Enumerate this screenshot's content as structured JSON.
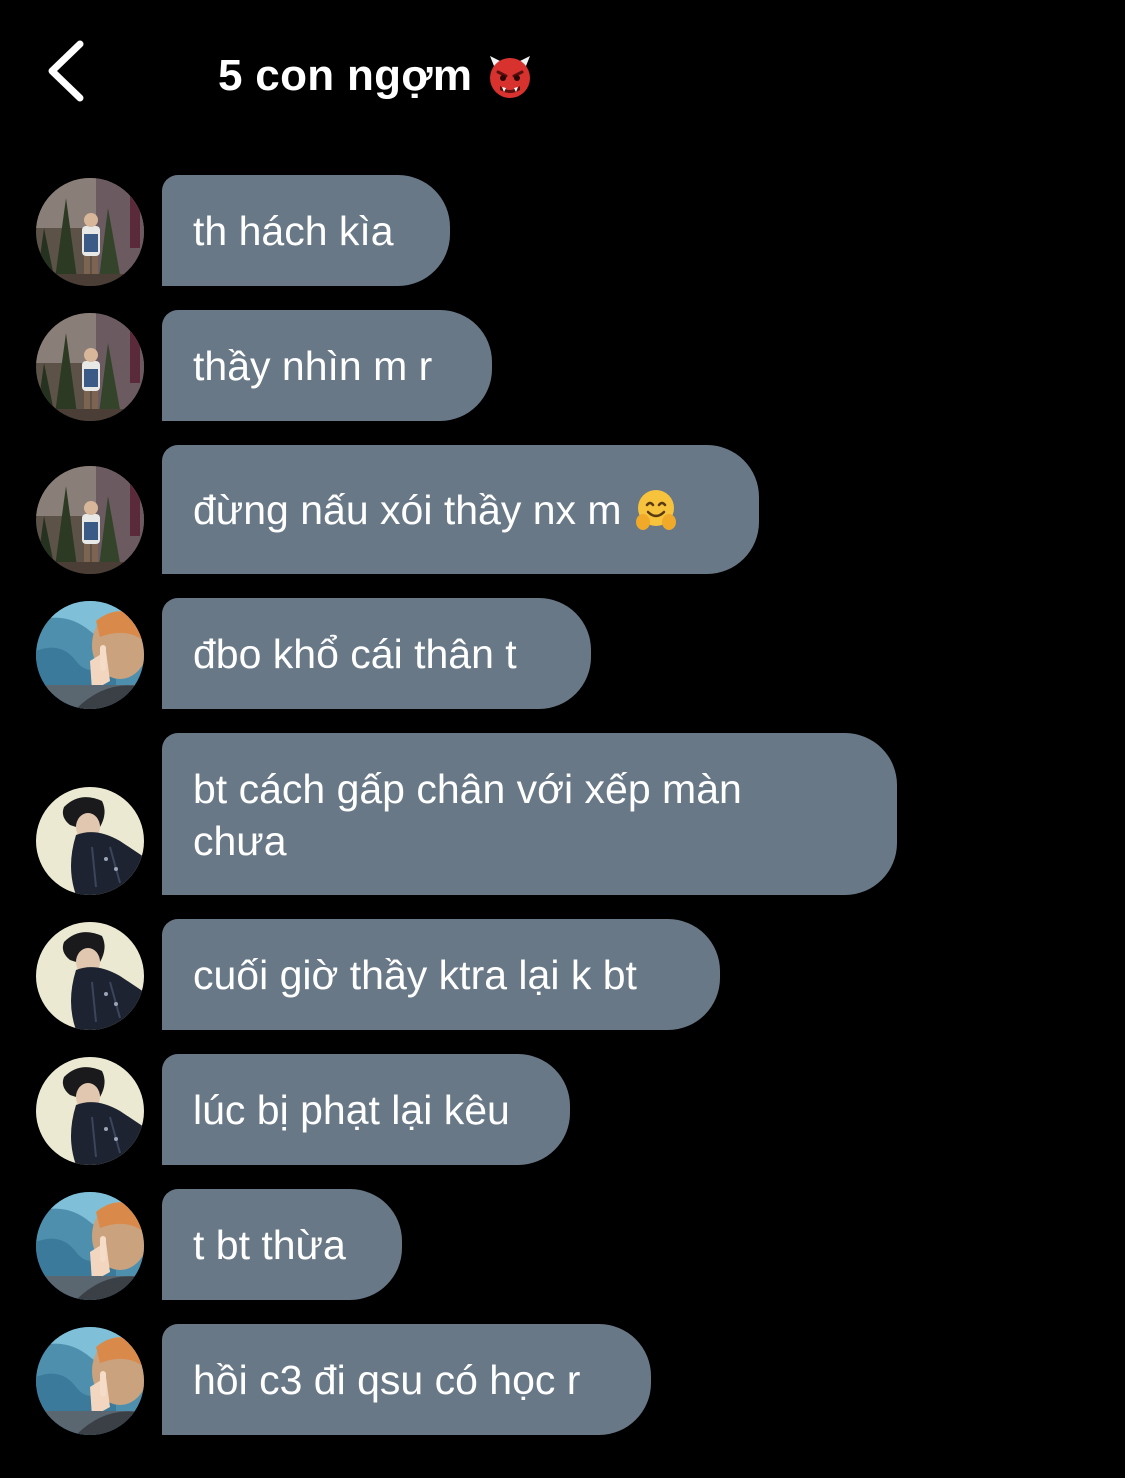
{
  "header": {
    "title": "5 con ngợm",
    "title_icon": "ogre-icon",
    "back_icon": "chevron-left-icon"
  },
  "colors": {
    "background": "#000000",
    "bubble": "#687887",
    "text": "#ffffff"
  },
  "messages": [
    {
      "avatar": "avatar-a",
      "text": "th hách kìa"
    },
    {
      "avatar": "avatar-a",
      "text": "thầy nhìn m r"
    },
    {
      "avatar": "avatar-a",
      "text": "đừng nấu xói thầy nx m",
      "emoji": "hugging-face-icon"
    },
    {
      "avatar": "avatar-b",
      "text": "đbo khổ cái thân t"
    },
    {
      "avatar": "avatar-c",
      "text": "bt cách gấp chân với xếp màn chưa"
    },
    {
      "avatar": "avatar-c",
      "text": "cuối giờ thầy ktra lại k bt"
    },
    {
      "avatar": "avatar-c",
      "text": "lúc bị phạt lại kêu"
    },
    {
      "avatar": "avatar-b",
      "text": "t bt thừa"
    },
    {
      "avatar": "avatar-b",
      "text": "hồi c3 đi qsu có học r"
    }
  ]
}
